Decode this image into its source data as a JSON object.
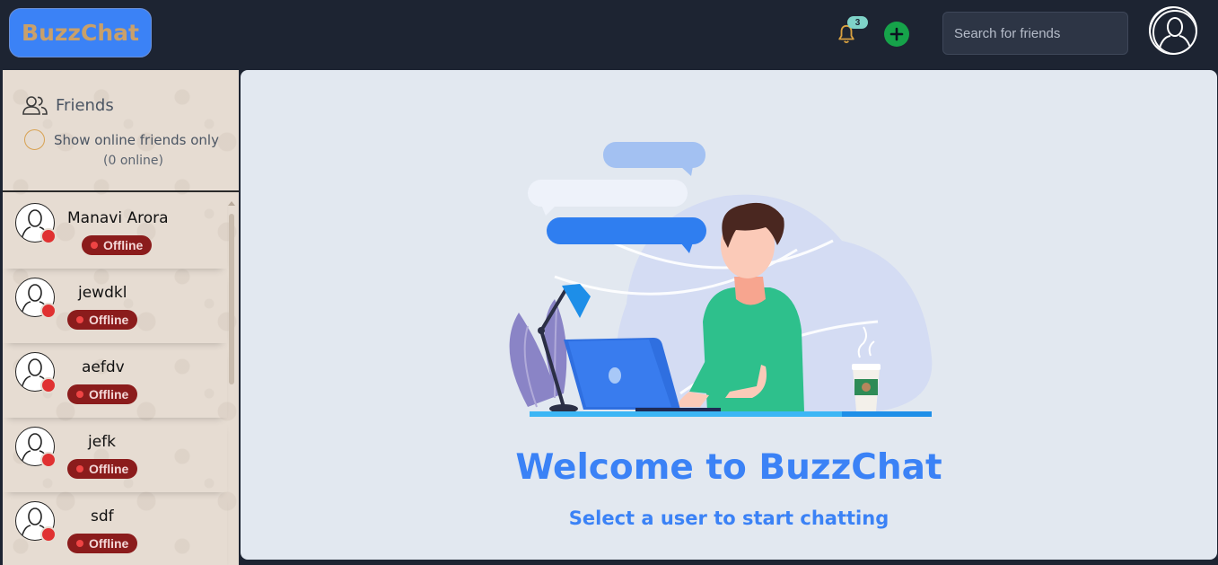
{
  "app": {
    "brand": "BuzzChat",
    "notification_count": "3",
    "search_placeholder": "Search for friends"
  },
  "sidebar": {
    "title": "Friends",
    "online_toggle_label": "Show online friends only",
    "online_count": "(0 online)",
    "friends": [
      {
        "name": "Manavi Arora",
        "status": "Offline"
      },
      {
        "name": "jewdkl",
        "status": "Offline"
      },
      {
        "name": "aefdv",
        "status": "Offline"
      },
      {
        "name": "jefk",
        "status": "Offline"
      },
      {
        "name": "sdf",
        "status": "Offline"
      }
    ]
  },
  "main": {
    "welcome_title": "Welcome to BuzzChat",
    "welcome_subtitle": "Select a user to start chatting"
  },
  "colors": {
    "topbar_bg": "#1d2432",
    "brand_button": "#3b82f6",
    "accent_text": "#3b82f6",
    "offline_badge": "#8b1c1c",
    "offline_dot": "#e03131",
    "add_button": "#16a34a"
  },
  "icons": {
    "notification": "bell-icon",
    "add": "plus-icon",
    "profile": "user-avatar-icon",
    "friends": "users-icon"
  }
}
